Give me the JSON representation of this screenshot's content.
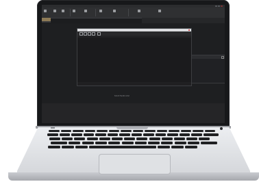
{
  "app": {
    "window_title": "",
    "ribbon_groups": [
      {
        "label": "",
        "icon": "new-icon"
      },
      {
        "label": "",
        "icon": "open-icon"
      },
      {
        "label": "",
        "icon": "save-icon"
      },
      {
        "label": "",
        "icon": "import-icon"
      },
      {
        "label": "",
        "icon": "export-icon"
      },
      {
        "label": "",
        "icon": "cut-icon"
      },
      {
        "label": "",
        "icon": "tools-icon"
      },
      {
        "label": "",
        "icon": "view-icon"
      },
      {
        "label": "",
        "icon": "settings-icon"
      }
    ],
    "info_bar": [
      ""
    ],
    "brand_text": "MASTERCAM"
  },
  "file_dialog": {
    "title": "",
    "path": "",
    "columns": [
      "",
      "",
      "",
      "",
      "",
      ""
    ]
  },
  "side_panel": {
    "title": "",
    "rows": [
      "",
      ""
    ]
  },
  "colors": {
    "lid": "#17181a",
    "screen_bg": "#1c1d1f",
    "accent_panel": "#8d7a56",
    "dialog_title": "#dcdde0",
    "close_red": "#c84a4a",
    "keys": "#1f2022",
    "aluminium": "#e3e5e8"
  }
}
